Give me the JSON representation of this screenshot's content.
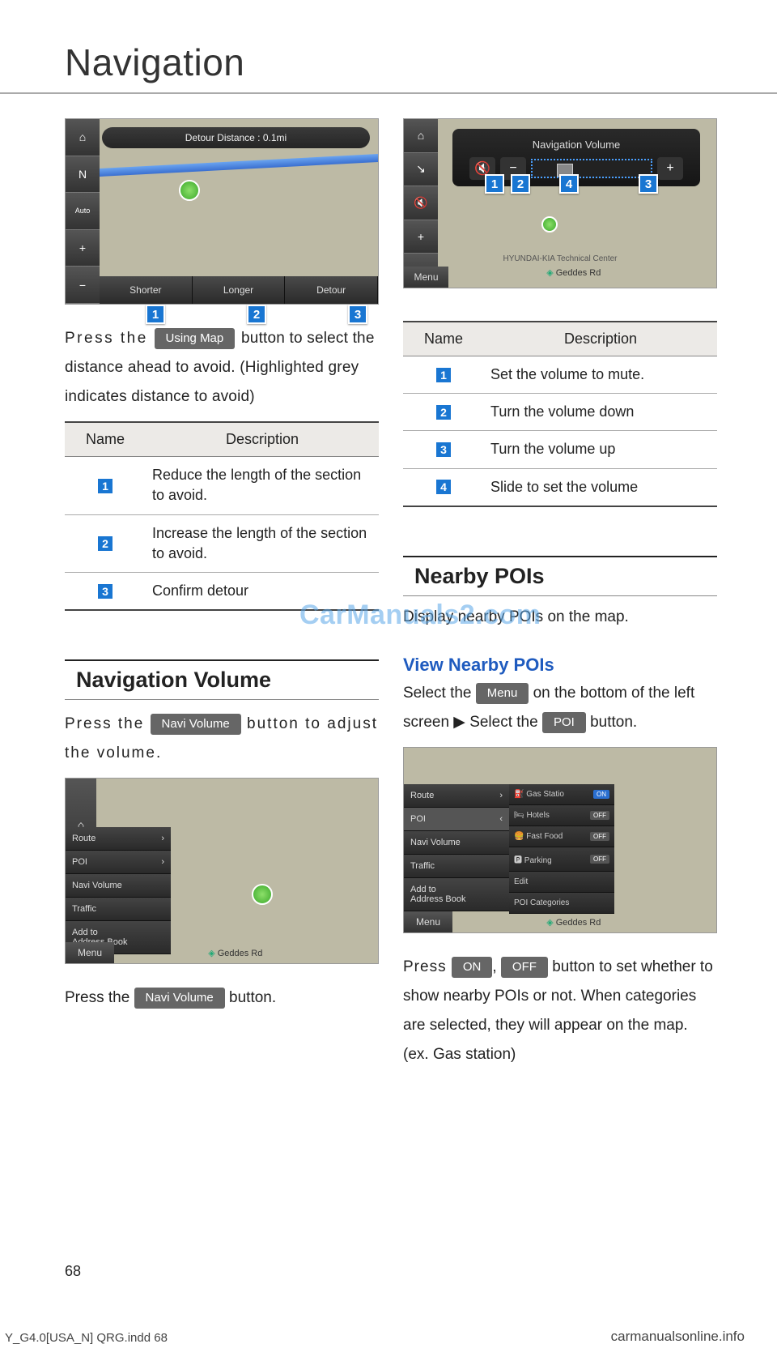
{
  "title": "Navigation",
  "watermark": "CarManuals2.com",
  "page_number": "68",
  "footer_left": "Y_G4.0[USA_N] QRG.indd   68",
  "footer_right": "carmanualsonline.info",
  "left": {
    "shot1": {
      "top_label": "Detour Distance : 0.1mi",
      "buttons": [
        "Shorter",
        "Longer",
        "Detour"
      ]
    },
    "callouts1": [
      "1",
      "2",
      "3"
    ],
    "p1_a": "Press the ",
    "p1_btn": "Using Map",
    "p1_b": " button to select the distance ahead to avoid. (Highlighted grey indicates distance to avoid)",
    "table1": {
      "head": [
        "Name",
        "Description"
      ],
      "rows": [
        {
          "n": "1",
          "d": "Reduce the length of the section to avoid."
        },
        {
          "n": "2",
          "d": "Increase the length of the section to avoid."
        },
        {
          "n": "3",
          "d": "Confirm detour"
        }
      ]
    },
    "section": "Navigation Volume",
    "p2_a": "Press the ",
    "p2_btn": "Navi Volume",
    "p2_b": " button to adjust the volume.",
    "shot3_menu": [
      "Route",
      "POI",
      "Navi Volume",
      "Traffic",
      "Add to\nAddress Book"
    ],
    "shot3_bottom": "Menu",
    "shot3_geddes": "Geddes Rd",
    "p3_a": "Press the ",
    "p3_btn": "Navi Volume",
    "p3_b": " button."
  },
  "right": {
    "shot2": {
      "title": "Navigation Volume",
      "hyundai": "HYUNDAI-KIA Technical Center",
      "geddes": "Geddes Rd",
      "badges": [
        "1",
        "2",
        "4",
        "3"
      ]
    },
    "table2": {
      "head": [
        "Name",
        "Description"
      ],
      "rows": [
        {
          "n": "1",
          "d": "Set the volume to mute."
        },
        {
          "n": "2",
          "d": "Turn the volume down"
        },
        {
          "n": "3",
          "d": "Turn the volume up"
        },
        {
          "n": "4",
          "d": "Slide to set the volume"
        }
      ]
    },
    "section": "Nearby POIs",
    "p1": "Display nearby POIs on the map.",
    "sub": "View Nearby POIs",
    "p2_a": "Select the ",
    "p2_btn1": "Menu",
    "p2_b": " on the bottom of the left screen ▶ Select the ",
    "p2_btn2": "POI",
    "p2_c": " button.",
    "shot4_menu": [
      "Route",
      "POI",
      "Navi Volume",
      "Traffic",
      "Add to\nAddress Book"
    ],
    "shot4_poi": [
      {
        "label": "Gas Statio",
        "state": "ON"
      },
      {
        "label": "Hotels",
        "state": "OFF"
      },
      {
        "label": "Fast Food",
        "state": "OFF"
      },
      {
        "label": "Parking",
        "state": "OFF"
      },
      {
        "label": "Edit",
        "state": ""
      },
      {
        "label": "POI Categories",
        "state": ""
      }
    ],
    "shot4_bottom": "Menu",
    "shot4_geddes": "Geddes Rd",
    "p3_a": "Press ",
    "p3_btn1": "ON",
    "p3_sep": ", ",
    "p3_btn2": "OFF",
    "p3_b": " button to set whether to show nearby POIs or not. When categories are selected, they will appear on the map. (ex. Gas station)"
  }
}
